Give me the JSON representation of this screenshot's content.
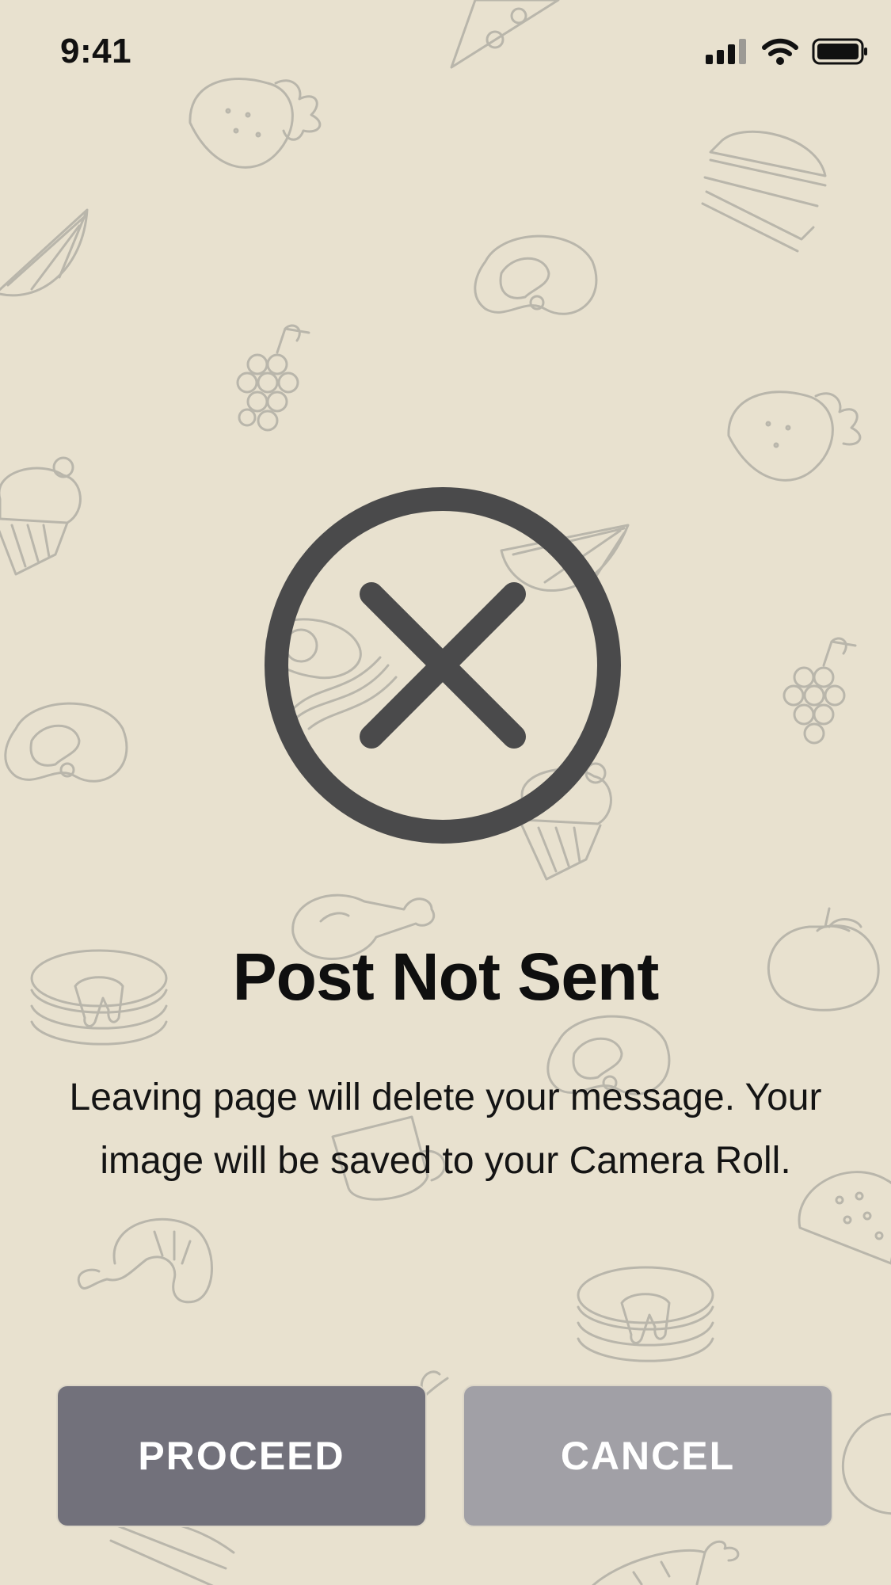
{
  "status_bar": {
    "time": "9:41",
    "icons": [
      "cellular-signal-icon",
      "wifi-icon",
      "battery-icon"
    ]
  },
  "dialog": {
    "icon": "close-circle-icon",
    "title": "Post Not Sent",
    "message": "Leaving page will delete your message. Your image will be saved to your Camera Roll."
  },
  "actions": {
    "proceed_label": "PROCEED",
    "cancel_label": "CANCEL"
  },
  "background": {
    "color": "#e8e1cf",
    "pattern_icons": [
      "pizza-icon",
      "strawberry-icon",
      "burger-icon",
      "lemon-icon",
      "steak-icon",
      "grapes-icon",
      "cupcake-icon",
      "egg-bacon-icon",
      "drumstick-icon",
      "tomato-icon",
      "pancakes-icon",
      "mug-icon",
      "shrimp-icon",
      "taco-icon",
      "carrot-icon"
    ]
  },
  "colors": {
    "icon_dark": "#4a4a4b",
    "proceed_button": "#72717b",
    "cancel_button": "#a1a0a6"
  }
}
